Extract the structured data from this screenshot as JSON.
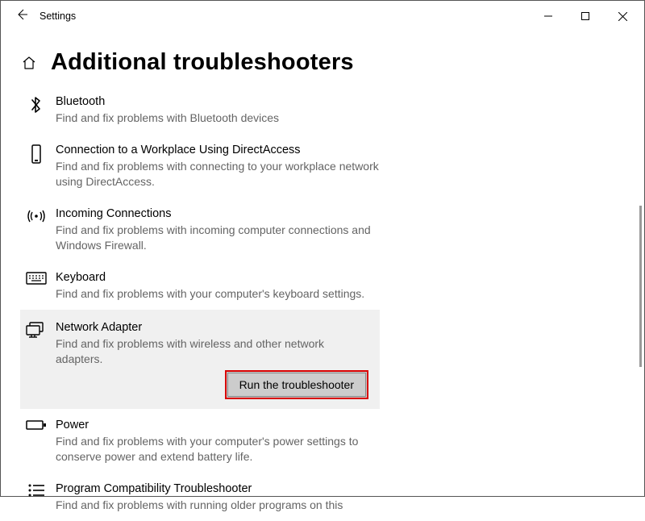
{
  "window": {
    "title": "Settings"
  },
  "page": {
    "heading": "Additional troubleshooters"
  },
  "items": {
    "bluetooth": {
      "title": "Bluetooth",
      "desc": "Find and fix problems with Bluetooth devices"
    },
    "directaccess": {
      "title": "Connection to a Workplace Using DirectAccess",
      "desc": "Find and fix problems with connecting to your workplace network using DirectAccess."
    },
    "incoming": {
      "title": "Incoming Connections",
      "desc": "Find and fix problems with incoming computer connections and Windows Firewall."
    },
    "keyboard": {
      "title": "Keyboard",
      "desc": "Find and fix problems with your computer's keyboard settings."
    },
    "network": {
      "title": "Network Adapter",
      "desc": "Find and fix problems with wireless and other network adapters.",
      "run_label": "Run the troubleshooter"
    },
    "power": {
      "title": "Power",
      "desc": "Find and fix problems with your computer's power settings to conserve power and extend battery life."
    },
    "compat": {
      "title": "Program Compatibility Troubleshooter",
      "desc": "Find and fix problems with running older programs on this"
    }
  }
}
